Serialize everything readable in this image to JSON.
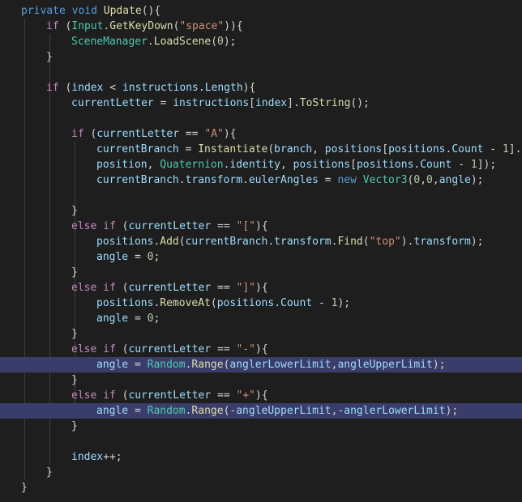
{
  "editor": {
    "colors": {
      "background": "#1e1e1e",
      "highlight": "#3a3d6a",
      "keyword": "#569cd6",
      "control": "#c586c0",
      "type": "#4ec9b0",
      "function": "#dcdcaa",
      "variable": "#9cdcfe",
      "string": "#ce9178",
      "number": "#b5cea8",
      "punctuation": "#d4d4d4"
    },
    "lines": [
      {
        "indent": 0,
        "tokens": [
          [
            "kw",
            "private"
          ],
          [
            "pun",
            " "
          ],
          [
            "kw",
            "void"
          ],
          [
            "pun",
            " "
          ],
          [
            "fn",
            "Update"
          ],
          [
            "pun",
            "(){"
          ]
        ]
      },
      {
        "indent": 1,
        "tokens": [
          [
            "ctl",
            "if"
          ],
          [
            "pun",
            " ("
          ],
          [
            "typ",
            "Input"
          ],
          [
            "pun",
            "."
          ],
          [
            "fn",
            "GetKeyDown"
          ],
          [
            "pun",
            "("
          ],
          [
            "str",
            "\"space\""
          ],
          [
            "pun",
            "))"
          ],
          [
            "pun",
            "{"
          ]
        ]
      },
      {
        "indent": 2,
        "tokens": [
          [
            "typ",
            "SceneManager"
          ],
          [
            "pun",
            "."
          ],
          [
            "fn",
            "LoadScene"
          ],
          [
            "pun",
            "("
          ],
          [
            "num",
            "0"
          ],
          [
            "pun",
            ");"
          ]
        ]
      },
      {
        "indent": 1,
        "tokens": [
          [
            "pun",
            "}"
          ]
        ]
      },
      {
        "indent": 0,
        "tokens": []
      },
      {
        "indent": 1,
        "tokens": [
          [
            "ctl",
            "if"
          ],
          [
            "pun",
            " ("
          ],
          [
            "var",
            "index"
          ],
          [
            "pun",
            " < "
          ],
          [
            "var",
            "instructions"
          ],
          [
            "pun",
            "."
          ],
          [
            "var",
            "Length"
          ],
          [
            "pun",
            "){"
          ]
        ]
      },
      {
        "indent": 2,
        "tokens": [
          [
            "var",
            "currentLetter"
          ],
          [
            "pun",
            " = "
          ],
          [
            "var",
            "instructions"
          ],
          [
            "pun",
            "["
          ],
          [
            "var",
            "index"
          ],
          [
            "pun",
            "]."
          ],
          [
            "fn",
            "ToString"
          ],
          [
            "pun",
            "();"
          ]
        ]
      },
      {
        "indent": 0,
        "tokens": []
      },
      {
        "indent": 2,
        "tokens": [
          [
            "ctl",
            "if"
          ],
          [
            "pun",
            " ("
          ],
          [
            "var",
            "currentLetter"
          ],
          [
            "pun",
            " == "
          ],
          [
            "str",
            "\"A\""
          ],
          [
            "pun",
            "){"
          ]
        ]
      },
      {
        "indent": 3,
        "tokens": [
          [
            "var",
            "currentBranch"
          ],
          [
            "pun",
            " = "
          ],
          [
            "fn",
            "Instantiate"
          ],
          [
            "pun",
            "("
          ],
          [
            "var",
            "branch"
          ],
          [
            "pun",
            ", "
          ],
          [
            "var",
            "positions"
          ],
          [
            "pun",
            "["
          ],
          [
            "var",
            "positions"
          ],
          [
            "pun",
            "."
          ],
          [
            "var",
            "Count"
          ],
          [
            "pun",
            " - "
          ],
          [
            "num",
            "1"
          ],
          [
            "pun",
            "]."
          ]
        ]
      },
      {
        "indent": 3,
        "tokens": [
          [
            "var",
            "position"
          ],
          [
            "pun",
            ", "
          ],
          [
            "typ",
            "Quaternion"
          ],
          [
            "pun",
            "."
          ],
          [
            "var",
            "identity"
          ],
          [
            "pun",
            ", "
          ],
          [
            "var",
            "positions"
          ],
          [
            "pun",
            "["
          ],
          [
            "var",
            "positions"
          ],
          [
            "pun",
            "."
          ],
          [
            "var",
            "Count"
          ],
          [
            "pun",
            " - "
          ],
          [
            "num",
            "1"
          ],
          [
            "pun",
            "]);"
          ]
        ]
      },
      {
        "indent": 3,
        "tokens": [
          [
            "var",
            "currentBranch"
          ],
          [
            "pun",
            "."
          ],
          [
            "var",
            "transform"
          ],
          [
            "pun",
            "."
          ],
          [
            "var",
            "eulerAngles"
          ],
          [
            "pun",
            " = "
          ],
          [
            "kw",
            "new"
          ],
          [
            "pun",
            " "
          ],
          [
            "typ",
            "Vector3"
          ],
          [
            "pun",
            "("
          ],
          [
            "num",
            "0"
          ],
          [
            "pun",
            ","
          ],
          [
            "num",
            "0"
          ],
          [
            "pun",
            ","
          ],
          [
            "var",
            "angle"
          ],
          [
            "pun",
            ");"
          ]
        ]
      },
      {
        "indent": 0,
        "tokens": []
      },
      {
        "indent": 2,
        "tokens": [
          [
            "pun",
            "}"
          ]
        ]
      },
      {
        "indent": 2,
        "tokens": [
          [
            "ctl",
            "else"
          ],
          [
            "pun",
            " "
          ],
          [
            "ctl",
            "if"
          ],
          [
            "pun",
            " ("
          ],
          [
            "var",
            "currentLetter"
          ],
          [
            "pun",
            " == "
          ],
          [
            "str",
            "\"[\""
          ],
          [
            "pun",
            "){"
          ]
        ]
      },
      {
        "indent": 3,
        "tokens": [
          [
            "var",
            "positions"
          ],
          [
            "pun",
            "."
          ],
          [
            "fn",
            "Add"
          ],
          [
            "pun",
            "("
          ],
          [
            "var",
            "currentBranch"
          ],
          [
            "pun",
            "."
          ],
          [
            "var",
            "transform"
          ],
          [
            "pun",
            "."
          ],
          [
            "fn",
            "Find"
          ],
          [
            "pun",
            "("
          ],
          [
            "str",
            "\"top\""
          ],
          [
            "pun",
            ")."
          ],
          [
            "var",
            "transform"
          ],
          [
            "pun",
            ");"
          ]
        ]
      },
      {
        "indent": 3,
        "tokens": [
          [
            "var",
            "angle"
          ],
          [
            "pun",
            " = "
          ],
          [
            "num",
            "0"
          ],
          [
            "pun",
            ";"
          ]
        ]
      },
      {
        "indent": 2,
        "tokens": [
          [
            "pun",
            "}"
          ]
        ]
      },
      {
        "indent": 2,
        "tokens": [
          [
            "ctl",
            "else"
          ],
          [
            "pun",
            " "
          ],
          [
            "ctl",
            "if"
          ],
          [
            "pun",
            " ("
          ],
          [
            "var",
            "currentLetter"
          ],
          [
            "pun",
            " == "
          ],
          [
            "str",
            "\"]\""
          ],
          [
            "pun",
            "){"
          ]
        ]
      },
      {
        "indent": 3,
        "tokens": [
          [
            "var",
            "positions"
          ],
          [
            "pun",
            "."
          ],
          [
            "fn",
            "RemoveAt"
          ],
          [
            "pun",
            "("
          ],
          [
            "var",
            "positions"
          ],
          [
            "pun",
            "."
          ],
          [
            "var",
            "Count"
          ],
          [
            "pun",
            " - "
          ],
          [
            "num",
            "1"
          ],
          [
            "pun",
            ");"
          ]
        ]
      },
      {
        "indent": 3,
        "tokens": [
          [
            "var",
            "angle"
          ],
          [
            "pun",
            " = "
          ],
          [
            "num",
            "0"
          ],
          [
            "pun",
            ";"
          ]
        ]
      },
      {
        "indent": 2,
        "tokens": [
          [
            "pun",
            "}"
          ]
        ]
      },
      {
        "indent": 2,
        "tokens": [
          [
            "ctl",
            "else"
          ],
          [
            "pun",
            " "
          ],
          [
            "ctl",
            "if"
          ],
          [
            "pun",
            " ("
          ],
          [
            "var",
            "currentLetter"
          ],
          [
            "pun",
            " == "
          ],
          [
            "str",
            "\"-\""
          ],
          [
            "pun",
            "){"
          ]
        ]
      },
      {
        "indent": 3,
        "highlight": true,
        "tokens": [
          [
            "var",
            "angle"
          ],
          [
            "pun",
            " = "
          ],
          [
            "typ",
            "Random"
          ],
          [
            "pun",
            "."
          ],
          [
            "fn",
            "Range"
          ],
          [
            "pun",
            "("
          ],
          [
            "var",
            "anglerLowerLimit"
          ],
          [
            "pun",
            ","
          ],
          [
            "var",
            "angleUpperLimit"
          ],
          [
            "pun",
            ");"
          ]
        ]
      },
      {
        "indent": 2,
        "tokens": [
          [
            "pun",
            "}"
          ]
        ]
      },
      {
        "indent": 2,
        "tokens": [
          [
            "ctl",
            "else"
          ],
          [
            "pun",
            " "
          ],
          [
            "ctl",
            "if"
          ],
          [
            "pun",
            " ("
          ],
          [
            "var",
            "currentLetter"
          ],
          [
            "pun",
            " == "
          ],
          [
            "str",
            "\"+\""
          ],
          [
            "pun",
            "){"
          ]
        ]
      },
      {
        "indent": 3,
        "highlight": true,
        "tokens": [
          [
            "var",
            "angle"
          ],
          [
            "pun",
            " = "
          ],
          [
            "typ",
            "Random"
          ],
          [
            "pun",
            "."
          ],
          [
            "fn",
            "Range"
          ],
          [
            "pun",
            "(-"
          ],
          [
            "var",
            "angleUpperLimit"
          ],
          [
            "pun",
            ",-"
          ],
          [
            "var",
            "anglerLowerLimit"
          ],
          [
            "pun",
            ");"
          ]
        ]
      },
      {
        "indent": 2,
        "tokens": [
          [
            "pun",
            "}"
          ]
        ]
      },
      {
        "indent": 0,
        "tokens": []
      },
      {
        "indent": 2,
        "tokens": [
          [
            "var",
            "index"
          ],
          [
            "pun",
            "++;"
          ]
        ]
      },
      {
        "indent": 1,
        "tokens": [
          [
            "pun",
            "}"
          ]
        ]
      },
      {
        "indent": 0,
        "tokens": [
          [
            "pun",
            "}"
          ]
        ]
      }
    ]
  }
}
